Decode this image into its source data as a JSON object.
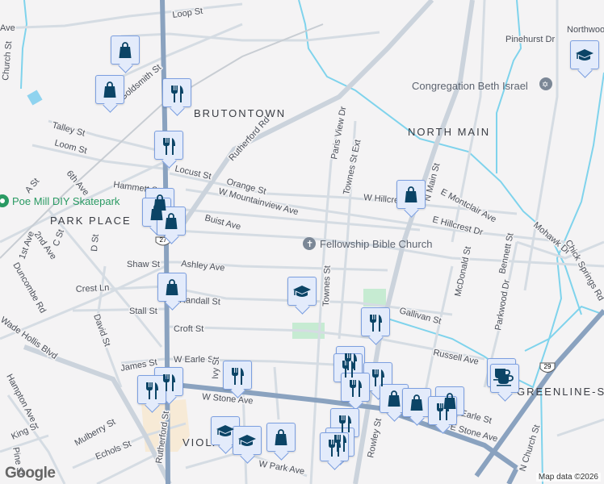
{
  "neighborhoods": [
    "BRUTONTOWN",
    "NORTH MAIN",
    "PARK PLACE",
    "VIOLA",
    "GREENLINE-SPA"
  ],
  "pois": {
    "church": "Fellowship Bible Church",
    "synagogue": "Congregation Beth Israel",
    "park": "Poe Mill DIY Skatepark"
  },
  "streets": [
    "Loop St",
    "Goldsmith St",
    "Rutherford Rd",
    "Talley St",
    "Loom St",
    "Locust St",
    "Hammett St",
    "Orange St",
    "W Mountainview Ave",
    "Buist Ave",
    "Shaw St",
    "Ashley Ave",
    "Crest Ln",
    "Randall St",
    "Stall St",
    "Croft St",
    "James St",
    "W Earle St",
    "W Stone Ave",
    "Rutherford St",
    "Paris View Dr",
    "Townes St Ext",
    "Townes St",
    "W Hillcrest",
    "E Montclair Ave",
    "E Hillcrest Dr",
    "N Main St",
    "Pinehurst Dr",
    "Northwood",
    "McDonald St",
    "Bennett St",
    "Parkwood Dr",
    "Gallivan St",
    "Russell Ave",
    "Mohawk Dr",
    "Chick Springs Rd",
    "E Stone Ave",
    "Rowley St",
    "Ivy St",
    "Mulberry St",
    "Echols St",
    "W Park Ave",
    "David St",
    "Hampton Ave",
    "King St",
    "Pine St",
    "Wade Hollis Blvd",
    "Church St",
    "A St",
    "6th Ave",
    "2nd Ave",
    "1st Ave",
    "C St",
    "D St",
    "N Church St",
    "Earle St",
    "Ave",
    "Duncombe Rd"
  ],
  "shields": [
    "27",
    "29"
  ],
  "markers": [
    "shopping",
    "shopping",
    "restaurant",
    "restaurant",
    "shopping",
    "shopping",
    "shopping",
    "shopping",
    "school",
    "restaurant",
    "shopping",
    "school",
    "restaurant",
    "restaurant",
    "restaurant",
    "restaurant",
    "restaurant",
    "restaurant",
    "restaurant",
    "shopping",
    "shopping",
    "shopping",
    "restaurant",
    "cafe",
    "cafe",
    "restaurant",
    "restaurant",
    "restaurant",
    "school",
    "school",
    "shopping"
  ],
  "attribution": "Map data ©2026",
  "logo": "Google",
  "colors": {
    "marker_fill": "#e3ebfb",
    "marker_icon": "#0b4466",
    "highway": "#8aa2bf",
    "water": "#7fd3ec"
  }
}
